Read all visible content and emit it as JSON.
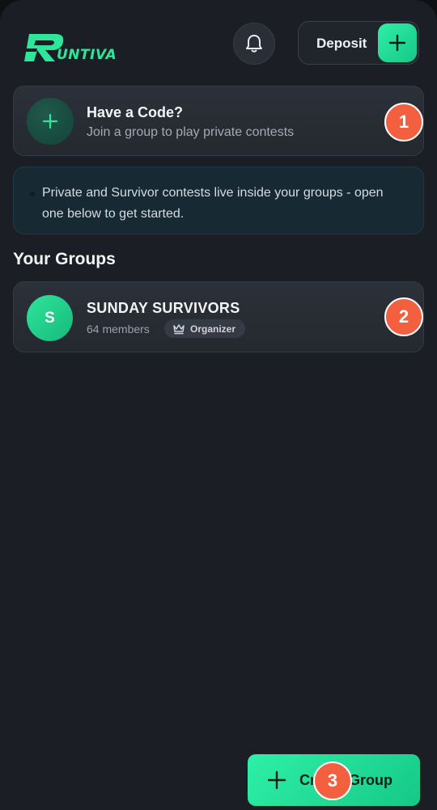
{
  "header": {
    "logo_text": "UNTIVA",
    "logo_letter": "R",
    "deposit_label": "Deposit"
  },
  "code_card": {
    "title": "Have a Code?",
    "subtitle": "Join a group to play private contests"
  },
  "info": {
    "text": "Private and Survivor contests live inside your groups - open one below to get started."
  },
  "groups": {
    "section_title": "Your Groups",
    "items": [
      {
        "initial": "S",
        "name": "SUNDAY SURVIVORS",
        "members": "64 members",
        "badge": "Organizer"
      }
    ]
  },
  "steps": [
    "1",
    "2",
    "3"
  ],
  "create_button": {
    "label": "Create Group"
  },
  "colors": {
    "accent": "#2ee59a",
    "background": "#1b1f25",
    "step_marker": "#f2603f"
  },
  "icons": {
    "bell": "bell-icon",
    "plus": "plus-icon",
    "crown": "crown-icon"
  }
}
